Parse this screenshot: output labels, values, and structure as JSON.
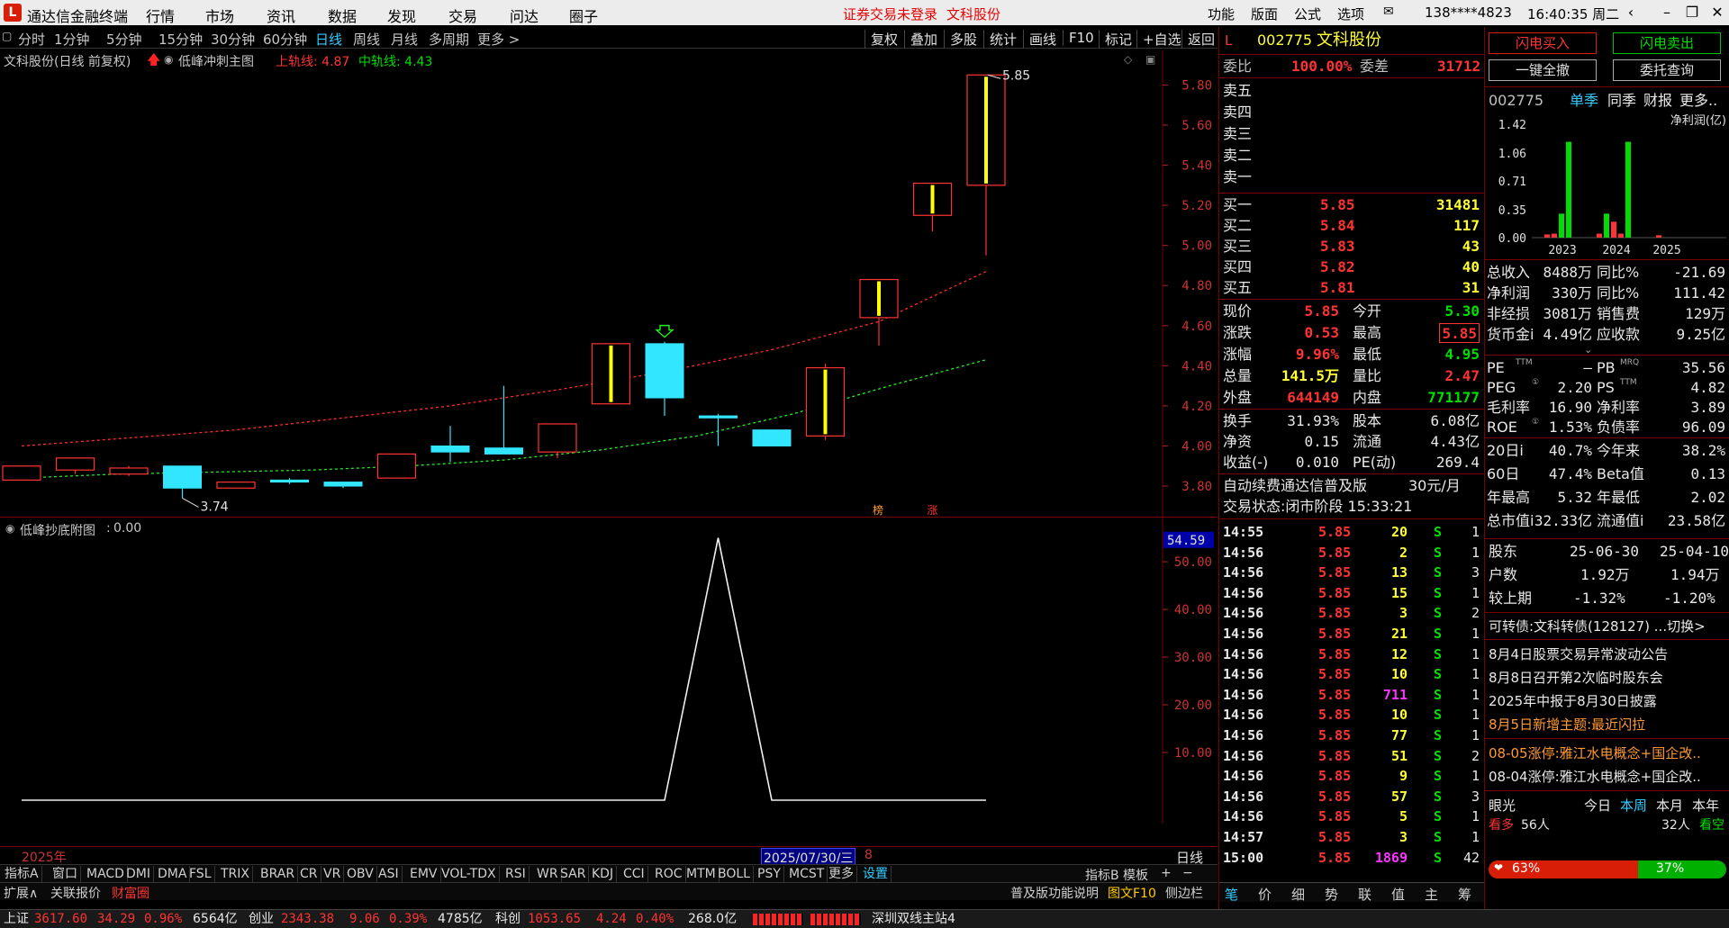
{
  "titlebar": {
    "app_title": "通达信金融终端",
    "menus": [
      "行情",
      "市场",
      "资讯",
      "数据",
      "发现",
      "交易",
      "问达",
      "圈子"
    ],
    "center_notice": "证券交易未登录",
    "center_stock": "文科股份",
    "right_menus": [
      "功能",
      "版面",
      "公式",
      "选项"
    ],
    "account": "138****4823",
    "clock": "16:40:35 周二"
  },
  "periods": [
    "分时",
    "1分钟",
    "5分钟",
    "15分钟",
    "30分钟",
    "60分钟",
    "日线",
    "周线",
    "月线",
    "多周期",
    "更多 >"
  ],
  "active_period": "日线",
  "tools": [
    "复权",
    "叠加",
    "多股",
    "统计",
    "画线",
    "F10",
    "标记",
    "+自选",
    "返回"
  ],
  "main_chart": {
    "legend_name": "文科股份(日线 前复权)",
    "indicator_name": "低峰冲刺主图",
    "upper_label": "上轨线: 4.87",
    "mid_label": "中轨线: 4.43",
    "high_mark": "5.85",
    "low_mark": "3.74",
    "tag_bang": "榜",
    "tag_zhang": "涨",
    "y_ticks": [
      "5.80",
      "5.60",
      "5.40",
      "5.20",
      "5.00",
      "4.80",
      "4.60",
      "4.40",
      "4.20",
      "4.00",
      "3.80"
    ]
  },
  "chart_data": {
    "type": "candlestick",
    "y_range": [
      3.7,
      5.88
    ],
    "candles": [
      {
        "o": 3.83,
        "c": 3.9,
        "h": 3.9,
        "l": 3.83
      },
      {
        "o": 3.88,
        "c": 3.94,
        "h": 3.94,
        "l": 3.86
      },
      {
        "o": 3.86,
        "c": 3.89,
        "h": 3.9,
        "l": 3.85
      },
      {
        "o": 3.9,
        "c": 3.79,
        "h": 3.9,
        "l": 3.74
      },
      {
        "o": 3.79,
        "c": 3.82,
        "h": 3.82,
        "l": 3.79
      },
      {
        "o": 3.83,
        "c": 3.82,
        "h": 3.84,
        "l": 3.81
      },
      {
        "o": 3.82,
        "c": 3.8,
        "h": 3.82,
        "l": 3.79
      },
      {
        "o": 3.84,
        "c": 3.96,
        "h": 3.96,
        "l": 3.84
      },
      {
        "o": 4.0,
        "c": 3.97,
        "h": 4.1,
        "l": 3.92
      },
      {
        "o": 3.99,
        "c": 3.96,
        "h": 4.3,
        "l": 3.96
      },
      {
        "o": 3.97,
        "c": 4.11,
        "h": 4.11,
        "l": 3.94
      },
      {
        "o": 4.21,
        "c": 4.51,
        "h": 4.51,
        "l": 4.21
      },
      {
        "o": 4.51,
        "c": 4.24,
        "h": 4.52,
        "l": 4.15
      },
      {
        "o": 4.15,
        "c": 4.14,
        "h": 4.16,
        "l": 4.0
      },
      {
        "o": 4.08,
        "c": 4.0,
        "h": 4.08,
        "l": 4.0
      },
      {
        "o": 4.05,
        "c": 4.39,
        "h": 4.41,
        "l": 4.03
      },
      {
        "o": 4.64,
        "c": 4.83,
        "h": 4.83,
        "l": 4.5
      },
      {
        "o": 5.15,
        "c": 5.31,
        "h": 5.31,
        "l": 5.07
      },
      {
        "o": 5.3,
        "c": 5.85,
        "h": 5.85,
        "l": 4.95
      }
    ],
    "upper_band": [
      4.0,
      4.04,
      4.08,
      4.14,
      4.2,
      4.28,
      4.37,
      4.48,
      4.62,
      4.87
    ],
    "mid_band": [
      3.84,
      3.86,
      3.87,
      3.88,
      3.9,
      3.93,
      3.98,
      4.05,
      4.16,
      4.3,
      4.43
    ],
    "sub_indicator": {
      "name": "低峰抄底附图",
      "value": "0.00",
      "y_range": [
        0,
        57
      ],
      "current": "54.59",
      "y_ticks": [
        "50.00",
        "40.00",
        "30.00",
        "20.00",
        "10.00"
      ],
      "points": [
        0,
        0,
        0,
        0,
        0,
        0,
        0,
        0,
        0,
        0,
        0,
        0,
        0,
        55,
        0,
        0,
        0,
        0,
        0
      ]
    }
  },
  "sub_x_labels": {
    "start": "2025年",
    "date": "2025/07/30/三",
    "day": "8",
    "period": "日线"
  },
  "indicator_tabs": [
    "指标A",
    "窗口",
    "MACD",
    "DMI",
    "DMA",
    "FSL",
    "TRIX",
    "BRAR",
    "CR",
    "VR",
    "OBV",
    "ASI",
    "EMV",
    "VOL-TDX",
    "RSI",
    "WR",
    "SAR",
    "KDJ",
    "CCI",
    "ROC",
    "MTM",
    "BOLL",
    "PSY",
    "MCST",
    "更多",
    "设置"
  ],
  "indicator_right": [
    "指标B",
    "模板",
    "+",
    "−"
  ],
  "bottom_left": [
    "扩展∧",
    "关联报价",
    "财富圈"
  ],
  "bottom_right": [
    "普及版功能说明",
    "图文F10",
    "侧边栏"
  ],
  "quote": {
    "code": "002775",
    "name": "文科股份",
    "weibi_label": "委比",
    "weibi": "100.00%",
    "weicha_label": "委差",
    "weicha": "31712",
    "sells": [
      {
        "label": "卖五"
      },
      {
        "label": "卖四"
      },
      {
        "label": "卖三"
      },
      {
        "label": "卖二"
      },
      {
        "label": "卖一"
      }
    ],
    "buys": [
      {
        "label": "买一",
        "price": "5.85",
        "vol": "31481"
      },
      {
        "label": "买二",
        "price": "5.84",
        "vol": "117"
      },
      {
        "label": "买三",
        "price": "5.83",
        "vol": "43"
      },
      {
        "label": "买四",
        "price": "5.82",
        "vol": "40"
      },
      {
        "label": "买五",
        "price": "5.81",
        "vol": "31"
      }
    ],
    "stats": [
      {
        "l1": "现价",
        "v1": "5.85",
        "c1": "red",
        "l2": "今开",
        "v2": "5.30",
        "c2": "green"
      },
      {
        "l1": "涨跌",
        "v1": "0.53",
        "c1": "red",
        "l2": "最高",
        "v2": "5.85",
        "c2": "red"
      },
      {
        "l1": "涨幅",
        "v1": "9.96%",
        "c1": "red",
        "l2": "最低",
        "v2": "4.95",
        "c2": "green"
      },
      {
        "l1": "总量",
        "v1": "141.5万",
        "c1": "yellow",
        "l2": "量比",
        "v2": "2.47",
        "c2": "red"
      },
      {
        "l1": "外盘",
        "v1": "644149",
        "c1": "red",
        "l2": "内盘",
        "v2": "771177",
        "c2": "green"
      }
    ],
    "stats2": [
      {
        "l1": "换手",
        "v1": "31.93%",
        "l2": "股本",
        "v2": "6.08亿"
      },
      {
        "l1": "净资",
        "v1": "0.15",
        "l2": "流通",
        "v2": "4.43亿"
      },
      {
        "l1": "收益(-)",
        "v1": "0.010",
        "l2": "PE(动)",
        "v2": "269.4"
      }
    ],
    "promo": "自动续费通达信普及版",
    "promo_price": "30元/月",
    "trade_status": "交易状态:闭市阶段 15:33:21",
    "ticks": [
      {
        "t": "14:55",
        "p": "5.85",
        "v": "20",
        "s": "S",
        "n": "1"
      },
      {
        "t": "14:56",
        "p": "5.85",
        "v": "2",
        "s": "S",
        "n": "1"
      },
      {
        "t": "14:56",
        "p": "5.85",
        "v": "13",
        "s": "S",
        "n": "3"
      },
      {
        "t": "14:56",
        "p": "5.85",
        "v": "15",
        "s": "S",
        "n": "1"
      },
      {
        "t": "14:56",
        "p": "5.85",
        "v": "3",
        "s": "S",
        "n": "2"
      },
      {
        "t": "14:56",
        "p": "5.85",
        "v": "21",
        "s": "S",
        "n": "1"
      },
      {
        "t": "14:56",
        "p": "5.85",
        "v": "12",
        "s": "S",
        "n": "1"
      },
      {
        "t": "14:56",
        "p": "5.85",
        "v": "10",
        "s": "S",
        "n": "1"
      },
      {
        "t": "14:56",
        "p": "5.85",
        "v": "711",
        "s": "S",
        "n": "1"
      },
      {
        "t": "14:56",
        "p": "5.85",
        "v": "10",
        "s": "S",
        "n": "1"
      },
      {
        "t": "14:56",
        "p": "5.85",
        "v": "77",
        "s": "S",
        "n": "1"
      },
      {
        "t": "14:56",
        "p": "5.85",
        "v": "51",
        "s": "S",
        "n": "2"
      },
      {
        "t": "14:56",
        "p": "5.85",
        "v": "9",
        "s": "S",
        "n": "1"
      },
      {
        "t": "14:56",
        "p": "5.85",
        "v": "57",
        "s": "S",
        "n": "3"
      },
      {
        "t": "14:56",
        "p": "5.85",
        "v": "5",
        "s": "S",
        "n": "1"
      },
      {
        "t": "14:57",
        "p": "5.85",
        "v": "3",
        "s": "S",
        "n": "1"
      },
      {
        "t": "15:00",
        "p": "5.85",
        "v": "1869",
        "s": "S",
        "n": "42"
      }
    ],
    "tick_tabs": [
      "笔",
      "价",
      "细",
      "势",
      "联",
      "值",
      "主",
      "筹"
    ]
  },
  "trade": {
    "flash_buy": "闪电买入",
    "flash_sell": "闪电卖出",
    "cancel_all": "一键全撤",
    "query": "委托查询"
  },
  "finance": {
    "code": "002775",
    "tabs": [
      "单季",
      "同季",
      "财报",
      "更多.."
    ],
    "metric": "净利润(亿)",
    "y_ticks": [
      "1.42",
      "1.06",
      "0.71",
      "0.35",
      "0.00"
    ],
    "years": [
      "2023",
      "2024",
      "2025"
    ],
    "rows": [
      {
        "l1": "总收入",
        "v1": "8488万",
        "l2": "同比%",
        "v2": "-21.69"
      },
      {
        "l1": "净利润",
        "v1": "330万",
        "l2": "同比%",
        "v2": "111.42"
      },
      {
        "l1": "非经损",
        "v1": "3081万",
        "l2": "销售费",
        "v2": "129万"
      },
      {
        "l1": "货币金i",
        "v1": "4.49亿",
        "l2": "应收款",
        "v2": "9.25亿"
      }
    ],
    "rows2": [
      {
        "l1": "PE",
        "sup1": "TTM",
        "v1": "—",
        "l2": "PB",
        "sup2": "MRQ",
        "v2": "35.56"
      },
      {
        "l1": "PEG",
        "sup1": "①",
        "v1": "2.20",
        "l2": "PS",
        "sup2": "TTM",
        "v2": "4.82"
      },
      {
        "l1": "毛利率",
        "sup1": "",
        "v1": "16.90",
        "l2": "净利率",
        "sup2": "",
        "v2": "3.89"
      },
      {
        "l1": "ROE",
        "sup1": "①",
        "v1": "1.53%",
        "l2": "负债率",
        "sup2": "",
        "v2": "96.09"
      }
    ],
    "rows3": [
      {
        "l1": "20日i",
        "v1": "40.7%",
        "l2": "今年来",
        "v2": "38.2%"
      },
      {
        "l1": "60日",
        "v1": "47.4%",
        "l2": "Beta值",
        "v2": "0.13"
      },
      {
        "l1": "年最高",
        "v1": "5.32",
        "l2": "年最低",
        "v2": "2.02"
      },
      {
        "l1": "总市值i",
        "v1": "32.33亿",
        "l2": "流通值i",
        "v2": "23.58亿"
      }
    ],
    "holder_label": "股东",
    "holder_d1": "25-06-30",
    "holder_d2": "25-04-10",
    "hushu_label": "户数",
    "hushu1": "1.92万",
    "hushu2": "1.94万",
    "jiao_label": "较上期",
    "jiao1": "-1.32%",
    "jiao2": "-1.20%",
    "bond": "可转债:文科转债(128127) ...切换>",
    "news": [
      "8月4日股票交易异常波动公告",
      "8月8日召开第2次临时股东会",
      "2025年中报于8月30日披露"
    ],
    "news_hot": "8月5日新增主题:最近闪拉",
    "limit_news": [
      "08-05涨停:雅江水电概念+国企改..",
      "08-04涨停:雅江水电概念+国企改.."
    ],
    "yanguang": "眼光",
    "tabs2": [
      "今日",
      "本周",
      "本月",
      "本年"
    ],
    "bull_label": "看多",
    "bull_count": "56人",
    "bear_count": "32人",
    "bear_label": "看空",
    "bull_pct": "63%",
    "bear_pct": "37%"
  },
  "status": {
    "sh_label": "上证",
    "sh_val": "3617.60",
    "sh_chg": "34.29",
    "sh_pct": "0.96%",
    "sh_amt": "6564亿",
    "cy_label": "创业",
    "cy_val": "2343.38",
    "cy_chg": "9.06",
    "cy_pct": "0.39%",
    "cy_amt": "4785亿",
    "kc_label": "科创",
    "kc_val": "1053.65",
    "kc_chg": "4.24",
    "kc_pct": "0.40%",
    "kc_amt": "268.0亿",
    "server": "深圳双线主站4"
  }
}
